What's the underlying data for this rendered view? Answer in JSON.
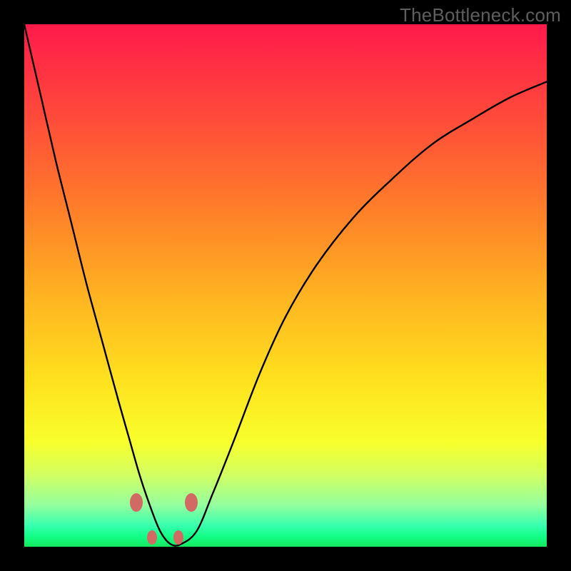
{
  "watermark": "TheBottleneck.com",
  "colors": {
    "black": "#000000",
    "curve": "#000000",
    "dot": "#d06a63",
    "watermark": "#5e5e5e"
  },
  "chart_data": {
    "type": "line",
    "title": "",
    "xlabel": "",
    "ylabel": "",
    "xlim": [
      0,
      100
    ],
    "ylim": [
      0,
      100
    ],
    "grid": false,
    "legend": null,
    "series": [
      {
        "name": "bottleneck-curve",
        "x": [
          0,
          3,
          6,
          9,
          12,
          15,
          18,
          20,
          22,
          24,
          26,
          28,
          30,
          33,
          36,
          40,
          45,
          50,
          56,
          63,
          70,
          78,
          86,
          93,
          100
        ],
        "y": [
          100,
          87,
          74,
          62,
          50,
          39,
          28,
          21,
          14,
          8,
          3,
          0.5,
          0.5,
          3,
          10,
          20,
          33,
          44,
          54,
          63,
          70,
          77,
          82,
          86,
          89
        ]
      }
    ],
    "markers": [
      {
        "x": 21.5,
        "y": 8.5
      },
      {
        "x": 24.5,
        "y": 1.8
      },
      {
        "x": 29.5,
        "y": 1.8
      },
      {
        "x": 32.0,
        "y": 8.5
      }
    ]
  }
}
